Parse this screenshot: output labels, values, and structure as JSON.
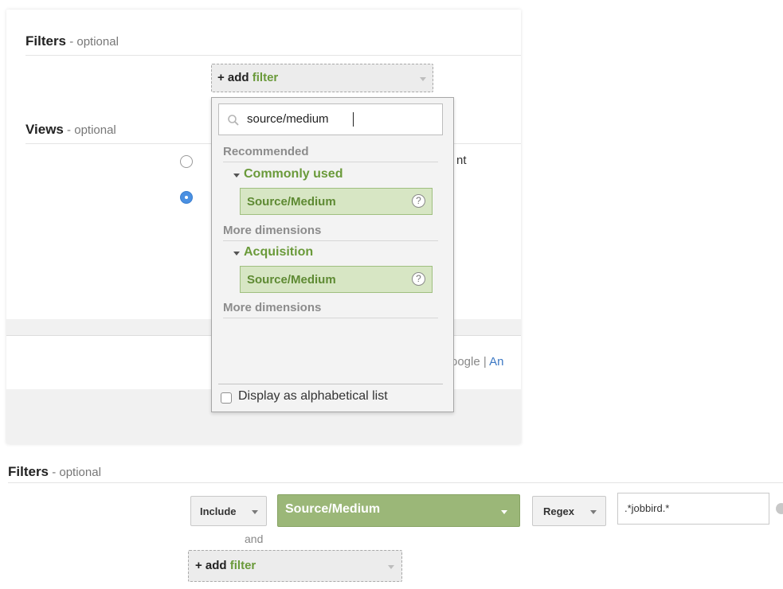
{
  "top_panel": {
    "filters_title": "Filters",
    "filters_optional": " - optional",
    "add_filter": {
      "plus": "+ add ",
      "word": "filter"
    },
    "views_title": "Views",
    "views_optional": " - optional",
    "radio_partial_text": "nt",
    "footer_partial": "oogle | ",
    "footer_link_partial": "An"
  },
  "dropdown": {
    "search_value": "source/medium",
    "sections": [
      {
        "heading": "Recommended",
        "group": "Commonly used",
        "item": "Source/Medium"
      },
      {
        "heading": "More dimensions",
        "group": "Acquisition",
        "item": "Source/Medium"
      }
    ],
    "trailing_heading": "More dimensions",
    "alphabetical_label": "Display as alphabetical list",
    "help_glyph": "?"
  },
  "bottom_panel": {
    "filters_title": "Filters",
    "filters_optional": " - optional",
    "include_label": "Include",
    "dimension_label": "Source/Medium",
    "match_label": "Regex",
    "expression_value": ".*jobbird.*",
    "and_label": "and",
    "add_filter": {
      "plus": "+ add ",
      "word": "filter"
    }
  },
  "colors": {
    "accent_green": "#6a9a3a",
    "selected_green": "#9bb778",
    "radio_blue": "#4a90e2"
  }
}
